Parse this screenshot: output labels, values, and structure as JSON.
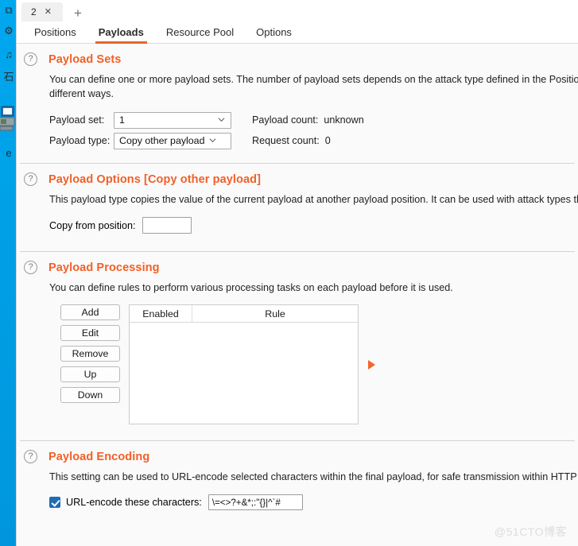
{
  "window": {
    "tab": {
      "label": "2",
      "close_icon": "close-icon",
      "add_icon": "plus-icon"
    },
    "nav_tabs": [
      {
        "label": "Positions",
        "active": false
      },
      {
        "label": "Payloads",
        "active": true
      },
      {
        "label": "Resource Pool",
        "active": false
      },
      {
        "label": "Options",
        "active": false
      }
    ]
  },
  "sections": {
    "payload_sets": {
      "help_icon": "question-mark-icon",
      "title": "Payload Sets",
      "description": "You can define one or more payload sets. The number of payload sets depends on the attack type defined in the Positions tab. V",
      "description_line2": "different ways.",
      "payload_set_label": "Payload set:",
      "payload_set_value": "1",
      "payload_type_label": "Payload type:",
      "payload_type_value": "Copy other payload",
      "payload_count_label": "Payload count:",
      "payload_count_value": "unknown",
      "request_count_label": "Request count:",
      "request_count_value": "0"
    },
    "payload_options": {
      "help_icon": "question-mark-icon",
      "title": "Payload Options [Copy other payload]",
      "description": "This payload type copies the value of the current payload at another payload position. It can be used with attack types that have",
      "copy_from_label": "Copy from position:",
      "copy_from_value": ""
    },
    "payload_processing": {
      "help_icon": "question-mark-icon",
      "title": "Payload Processing",
      "description": "You can define rules to perform various processing tasks on each payload before it is used.",
      "buttons": [
        "Add",
        "Edit",
        "Remove",
        "Up",
        "Down"
      ],
      "table": {
        "columns": [
          "Enabled",
          "Rule"
        ],
        "rows": []
      },
      "expand_icon": "play-triangle-icon"
    },
    "payload_encoding": {
      "help_icon": "question-mark-icon",
      "title": "Payload Encoding",
      "description": "This setting can be used to URL-encode selected characters within the final payload, for safe transmission within HTTP requests.",
      "checkbox_checked": true,
      "checkbox_label": "URL-encode these characters:",
      "characters_value": "\\=<>?+&*;:\"{}|^`#"
    }
  },
  "desktop": {
    "icons": [
      {
        "name": "app-icon-1",
        "glyph": "⧉"
      },
      {
        "name": "app-icon-2",
        "glyph": "⚙"
      },
      {
        "name": "music-icon",
        "glyph": "♫"
      },
      {
        "name": "dictionary-icon",
        "glyph": "石"
      },
      {
        "name": "computer-icon",
        "glyph": "Ὓ5"
      },
      {
        "name": "edge-icon",
        "glyph": "e"
      }
    ]
  },
  "watermark": "@51CTO博客"
}
